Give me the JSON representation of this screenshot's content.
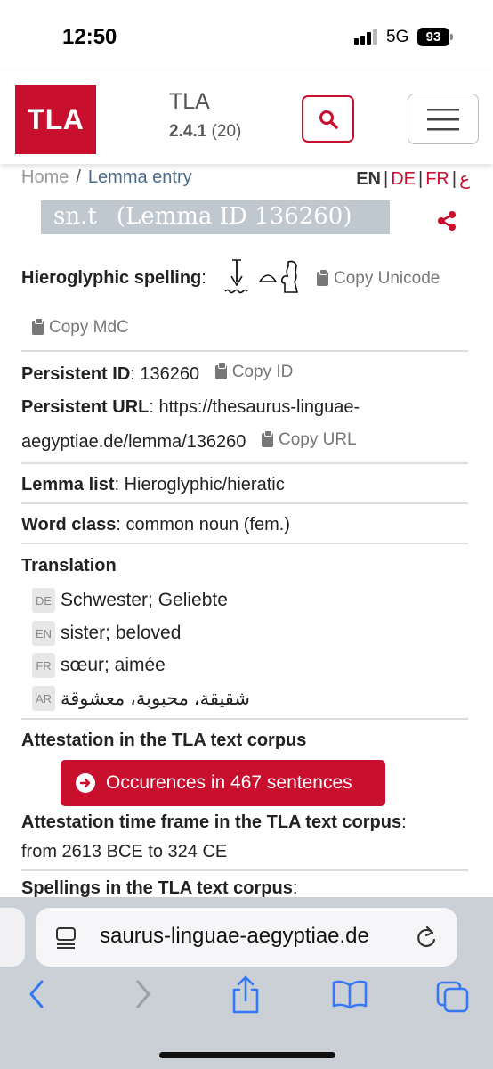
{
  "status_bar": {
    "time": "12:50",
    "network": "5G",
    "battery": "93"
  },
  "header": {
    "logo": "TLA",
    "app_name": "TLA",
    "version_bold": "2.4.1",
    "version_extra": "(20)",
    "search_icon": "search-icon",
    "menu_icon": "hamburger-icon"
  },
  "breadcrumb": {
    "home": "Home",
    "separator": "/",
    "current": "Lemma entry"
  },
  "languages": {
    "en": "EN",
    "de": "DE",
    "fr": "FR",
    "ar": "ع",
    "separator": "|"
  },
  "lemma": {
    "transliteration": "sn.t",
    "id_label": "(Lemma ID 136260)"
  },
  "fields": {
    "hieroglyphic_label": "Hieroglyphic spelling",
    "copy_unicode": "Copy Unicode",
    "copy_mdc": "Copy MdC",
    "persistent_id_label": "Persistent ID",
    "persistent_id": "136260",
    "copy_id": "Copy ID",
    "persistent_url_label": "Persistent URL",
    "persistent_url_line1": "https://thesaurus-linguae-",
    "persistent_url_line2": "aegyptiae.de/lemma/136260",
    "copy_url": "Copy URL",
    "lemma_list_label": "Lemma list",
    "lemma_list": "Hieroglyphic/hieratic",
    "word_class_label": "Word class",
    "word_class": "common noun (fem.)",
    "translation_label": "Translation",
    "attestation_label": "Attestation in the TLA text corpus",
    "occurrences_button": "Occurences in 467 sentences",
    "timeframe_label": "Attestation time frame in the TLA text corpus",
    "timeframe": "from 2613 BCE to 324 CE",
    "spellings_label": "Spellings in the TLA text corpus"
  },
  "translations": [
    {
      "lang": "DE",
      "text": "Schwester; Geliebte"
    },
    {
      "lang": "EN",
      "text": "sister; beloved"
    },
    {
      "lang": "FR",
      "text": "sœur; aimée"
    },
    {
      "lang": "AR",
      "text": "شقيقة، محبوبة، معشوقة"
    }
  ],
  "browser": {
    "url": "saurus-linguae-aegyptiae.de",
    "toolbar_icons": [
      "back-icon",
      "forward-icon",
      "share-icon",
      "bookmarks-icon",
      "tabs-icon"
    ]
  },
  "colors": {
    "brand_red": "#c8102e",
    "title_bg": "#bfc7cf",
    "link_blue": "#3478f6"
  }
}
